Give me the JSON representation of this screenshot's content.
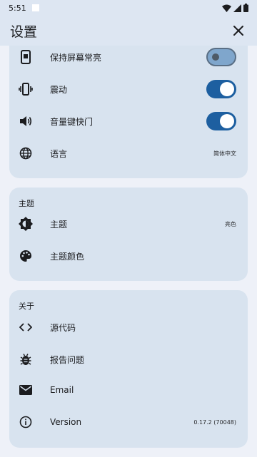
{
  "status_bar": {
    "time": "5:51"
  },
  "app_bar": {
    "title": "设置"
  },
  "general": {
    "items": [
      {
        "label": "保持屏幕常亮",
        "icon": "phone-screen-icon",
        "toggle": "off"
      },
      {
        "label": "震动",
        "icon": "vibration-icon",
        "toggle": "on"
      },
      {
        "label": "音量键快门",
        "icon": "volume-icon",
        "toggle": "on"
      },
      {
        "label": "语言",
        "icon": "globe-icon",
        "value": "简体中文"
      }
    ]
  },
  "theme_section": {
    "title": "主题",
    "items": [
      {
        "label": "主题",
        "icon": "brightness-icon",
        "value": "亮色"
      },
      {
        "label": "主题颜色",
        "icon": "palette-icon"
      }
    ]
  },
  "about_section": {
    "title": "关于",
    "items": [
      {
        "label": "源代码",
        "icon": "code-icon"
      },
      {
        "label": "报告问题",
        "icon": "bug-icon"
      },
      {
        "label": "Email",
        "icon": "mail-icon"
      },
      {
        "label": "Version",
        "icon": "info-icon",
        "value": "0.17.2 (70048)"
      }
    ]
  },
  "colors": {
    "accent": "#1d5fa0",
    "card": "#d8e3ef",
    "header": "#dde6f2"
  }
}
